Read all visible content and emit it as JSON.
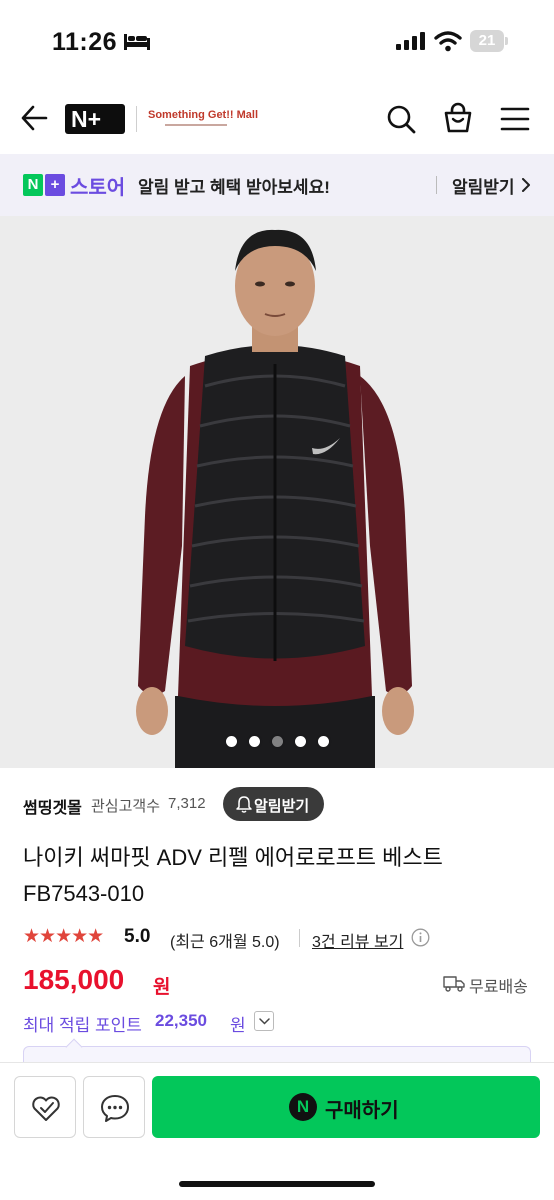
{
  "status_bar": {
    "time": "11:26",
    "battery_level": "21",
    "icons": [
      "bed-icon",
      "signal-icon",
      "wifi-icon",
      "battery-icon"
    ]
  },
  "header": {
    "icons": [
      "back-arrow-icon",
      "search-icon",
      "shopping-bag-icon",
      "hamburger-menu-icon"
    ],
    "logo_text": "N+",
    "mall_name": "Something Get!! Mall"
  },
  "store_banner": {
    "logo_n": "N",
    "logo_plus": "+",
    "label": "스토어",
    "message": "알림 받고 혜택 받아보세요!",
    "cta": "알림받기",
    "accent": "#6b4ce0",
    "green": "#04c75a"
  },
  "carousel": {
    "slide_count": 5,
    "active_index": 2
  },
  "seller": {
    "name": "썸띵겟몰",
    "follower_label": "관심고객수",
    "follower_count": "7,312",
    "alert_button": "알림받기"
  },
  "product": {
    "title_line1": "나이키 써마핏 ADV 리펠 에어로로프트 베스트",
    "title_line2": "FB7543-010",
    "stars": "★★★★★",
    "rating": "5.0",
    "recent_rating": "(최근 6개월 5.0)",
    "review_link": "3건 리뷰 보기",
    "price": "185,000",
    "price_unit": "원",
    "shipping": "무료배송",
    "points_label": "최대 적립 포인트",
    "points_value": "22,350",
    "points_unit": "원",
    "price_color": "#e8112d"
  },
  "bottom_bar": {
    "wish_icon": "heart-check-icon",
    "talk_icon": "chat-bubble-icon",
    "buy_icon_letter": "N",
    "buy_label": "구매하기",
    "buy_color": "#03c75a"
  }
}
